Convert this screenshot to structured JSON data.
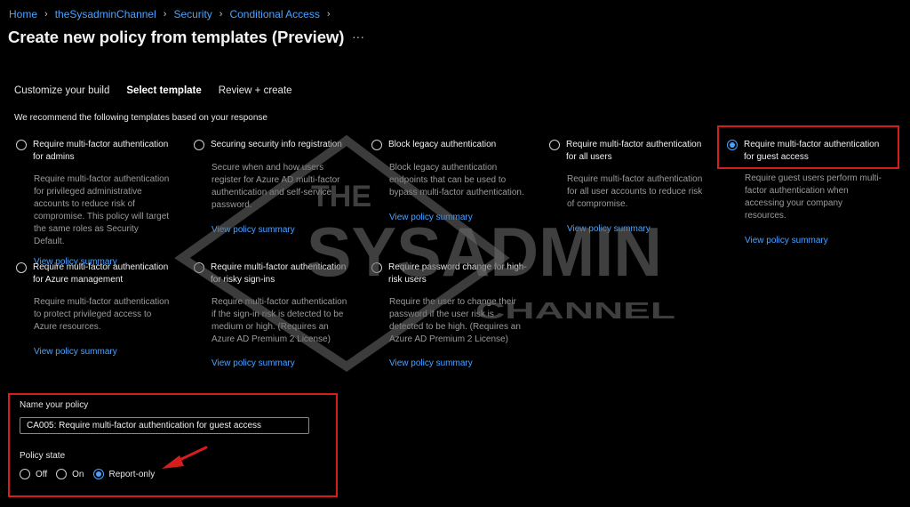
{
  "breadcrumb": [
    "Home",
    "theSysadminChannel",
    "Security",
    "Conditional Access"
  ],
  "page_title": "Create new policy from templates (Preview)",
  "more_label": "···",
  "tabs": [
    {
      "label": "Customize your build",
      "active": false
    },
    {
      "label": "Select template",
      "active": true
    },
    {
      "label": "Review + create",
      "active": false
    }
  ],
  "recommend_text": "We recommend the following templates based on your response",
  "templates": [
    {
      "title": "Require multi-factor authentication for admins",
      "description": "Require multi-factor authentication for privileged administrative accounts to reduce risk of compromise. This policy will target the same roles as Security Default.",
      "link": "View policy summary",
      "selected": false
    },
    {
      "title": "Securing security info registration",
      "description": "Secure when and how users register for Azure AD multi-factor authentication and self-service password.",
      "link": "View policy summary",
      "selected": false
    },
    {
      "title": "Block legacy authentication",
      "description": "Block legacy authentication endpoints that can be used to bypass multi-factor authentication.",
      "link": "View policy summary",
      "selected": false
    },
    {
      "title": "Require multi-factor authentication for all users",
      "description": "Require multi-factor authentication for all user accounts to reduce risk of compromise.",
      "link": "View policy summary",
      "selected": false
    },
    {
      "title": "Require multi-factor authentication for guest access",
      "description": "Require guest users perform multi-factor authentication when accessing your company resources.",
      "link": "View policy summary",
      "selected": true
    },
    {
      "title": "Require multi-factor authentication for Azure management",
      "description": "Require multi-factor authentication to protect privileged access to Azure resources.",
      "link": "View policy summary",
      "selected": false
    },
    {
      "title": "Require multi-factor authentication for risky sign-ins",
      "description": "Require multi-factor authentication if the sign-in risk is detected to be medium or high. (Requires an Azure AD Premium 2 License)",
      "link": "View policy summary",
      "selected": false
    },
    {
      "title": "Require password change for high-risk users",
      "description": "Require the user to change their password if the user risk is detected to be high. (Requires an Azure AD Premium 2 License)",
      "link": "View policy summary",
      "selected": false
    }
  ],
  "form": {
    "name_label": "Name your policy",
    "name_value": "CA005: Require multi-factor authentication for guest access",
    "state_label": "Policy state",
    "state_options": [
      "Off",
      "On",
      "Report-only"
    ],
    "state_selected": "Report-only"
  },
  "watermark": {
    "line1": "THE",
    "line2": "SYSADMIN",
    "line3": "CHANNEL"
  },
  "colors": {
    "accent": "#4aa3ff",
    "highlight": "#d41e1e",
    "background": "#000000"
  }
}
